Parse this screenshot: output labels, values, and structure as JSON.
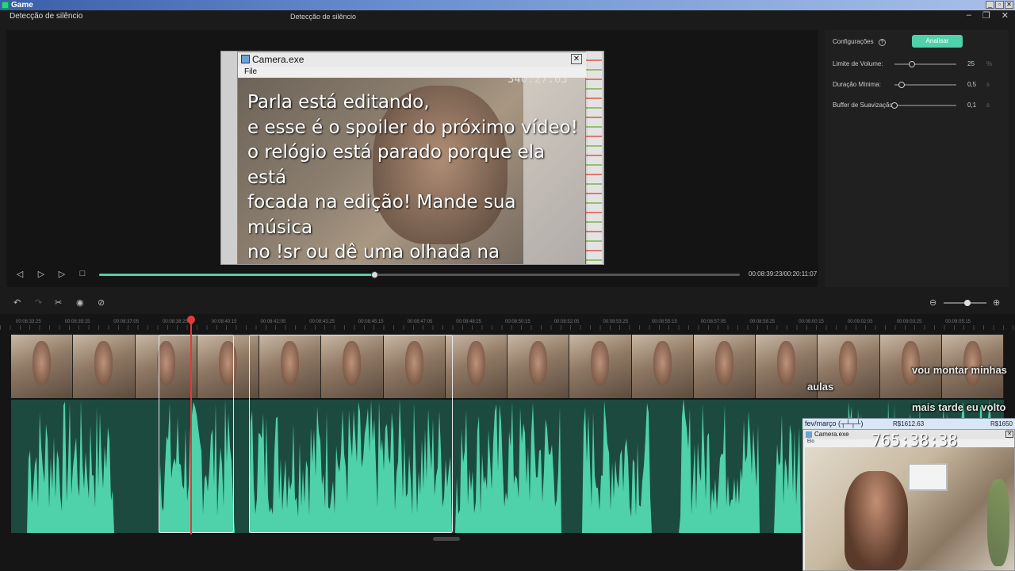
{
  "os_window": {
    "title": "Game",
    "controls": [
      "_",
      "▫",
      "✕"
    ]
  },
  "app": {
    "title_left": "Detecção de silêncio",
    "title_center": "Detecção de silêncio",
    "window_controls": [
      "–",
      "❐",
      "✕"
    ]
  },
  "preview": {
    "camera_window": {
      "title": "Camera.exe",
      "menu": "File",
      "close": "✕",
      "timer": "340:27:03",
      "overlay_text": "Parla está editando,\ne esse é o spoiler do próximo vídeo!\no relógio está parado porque ela está\nfocada na edição! Mande sua música\nno !sr ou dê uma olhada na\nprogramação!  :])"
    }
  },
  "transport": {
    "buttons": {
      "prev_frame": "◁",
      "next_frame": "▷",
      "play": "▷",
      "stop": "□"
    },
    "progress_fraction": 0.43,
    "timecode": "00:08:39:23/00:20:11:07"
  },
  "settings": {
    "header": "Configurações",
    "help_icon": "?",
    "analyze_button": "Analisar",
    "rows": [
      {
        "label": "Limite de Volume:",
        "value": "25",
        "unit": "%",
        "fraction": 0.28
      },
      {
        "label": "Duração Mínima:",
        "value": "0,5",
        "unit": "s",
        "fraction": 0.12
      },
      {
        "label": "Buffer de Suavização:",
        "value": "0,1",
        "unit": "s",
        "fraction": 0.0
      }
    ]
  },
  "timeline_toolbar": {
    "icons": {
      "undo": "↶",
      "redo": "↷",
      "cut": "✂",
      "eye": "◉",
      "hide": "⊘",
      "zoom_out": "⊖",
      "zoom_in": "⊕"
    },
    "zoom_fraction": 0.55
  },
  "timeline": {
    "ruler_ticks": [
      "00:08:33:25",
      "00:08:35:15",
      "00:08:37:05",
      "00:08:38:25",
      "00:08:40:15",
      "00:08:42:05",
      "00:08:43:25",
      "00:08:45:15",
      "00:08:47:05",
      "00:08:48:25",
      "00:08:50:15",
      "00:08:52:05",
      "00:08:53:25",
      "00:08:55:15",
      "00:08:57:05",
      "00:08:58:25",
      "00:09:00:15",
      "00:09:02:05",
      "00:09:03:25",
      "00:09:05:15"
    ],
    "selected_segments": 2
  },
  "stream_overlay": {
    "chat_lines": [
      "vou montar minhas",
      "aulas",
      "mais tarde eu volto"
    ],
    "donation_bar": {
      "label": "fev/março (┬┴┬┴)",
      "amount": "R$1612.63",
      "goal": "R$1650"
    },
    "webcam": {
      "title": "Camera.exe",
      "menu": "Elo",
      "timer": "765:38:38",
      "close": "✕"
    }
  },
  "colors": {
    "accent": "#4fd1a9",
    "playhead": "#e23a3a",
    "background": "#1b1b1b"
  }
}
